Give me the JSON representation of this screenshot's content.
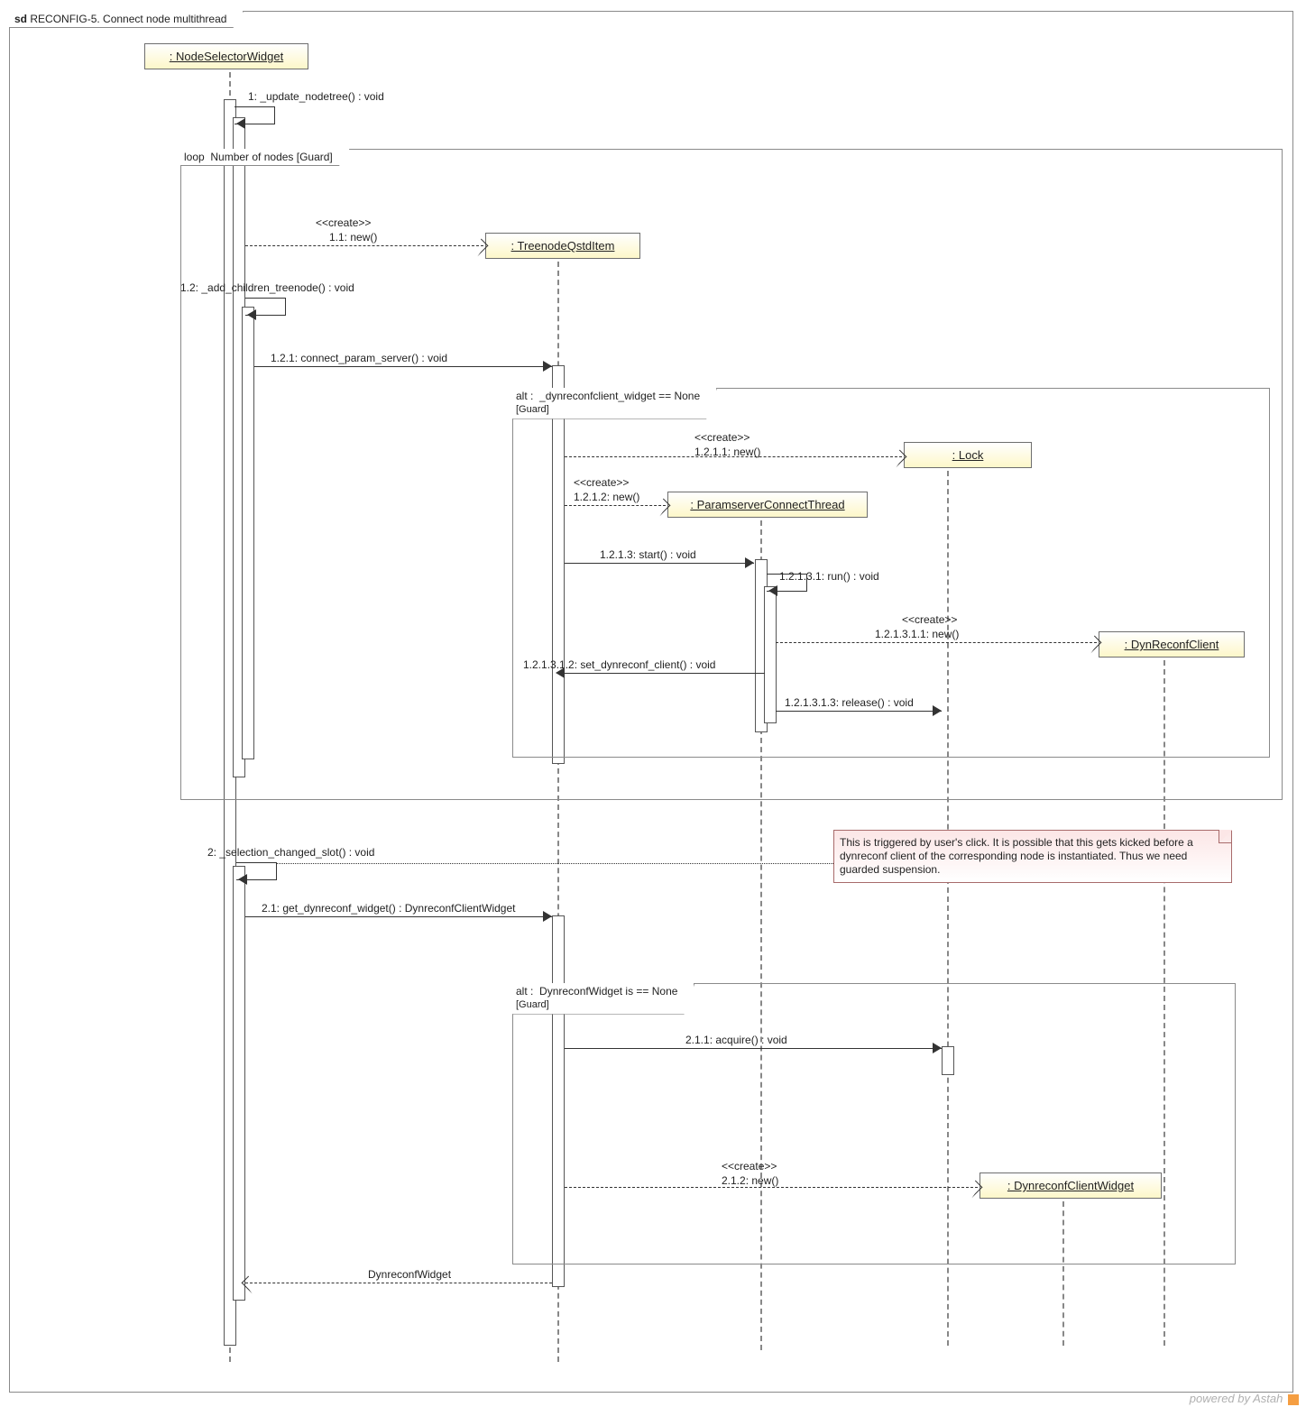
{
  "frame": {
    "prefix": "sd",
    "title": "RECONFIG-5. Connect node multithread"
  },
  "participants": {
    "nodeselector": ": NodeSelectorWidget",
    "treenode": ": TreenodeQstdItem",
    "lock": ": Lock",
    "paramthread": ": ParamserverConnectThread",
    "dynreconfclient": ": DynReconfClient",
    "dynreconfwidget": ": DynreconfClientWidget"
  },
  "fragments": {
    "loop": {
      "kind": "loop",
      "cond": "Number of nodes  [Guard]"
    },
    "alt1": {
      "kind": "alt",
      "cond": "_dynreconfclient_widget == None",
      "guard": "[Guard]"
    },
    "alt2": {
      "kind": "alt",
      "cond": "DynreconfWidget is == None",
      "guard": "[Guard]"
    }
  },
  "messages": {
    "m1": "1:  _update_nodetree() : void",
    "m11s": "<<create>>",
    "m11": "1.1: new()",
    "m12": "1.2: _add_children_treenode() : void",
    "m121": "1.2.1: connect_param_server() : void",
    "m1211s": "<<create>>",
    "m1211": "1.2.1.1: new()",
    "m1212s": "<<create>>",
    "m1212": "1.2.1.2: new()",
    "m1213": "1.2.1.3: start() : void",
    "m12131": "1.2.1.3.1: run() : void",
    "m121311s": "<<create>>",
    "m121311": "1.2.1.3.1.1: new()",
    "m121312": "1.2.1.3.1.2: set_dynreconf_client() : void",
    "m121313": "1.2.1.3.1.3: release() : void",
    "m2": "2: _selection_changed_slot() : void",
    "m21": "2.1: get_dynreconf_widget() : DynreconfClientWidget",
    "m211": "2.1.1: acquire() : void",
    "m212s": "<<create>>",
    "m212": "2.1.2: new()",
    "ret21": "DynreconfWidget"
  },
  "note": "This is triggered by user's click. It is possible that this gets kicked before a dynreconf client of the corresponding node is instantiated. Thus we need guarded suspension.",
  "footer": "powered by Astah"
}
